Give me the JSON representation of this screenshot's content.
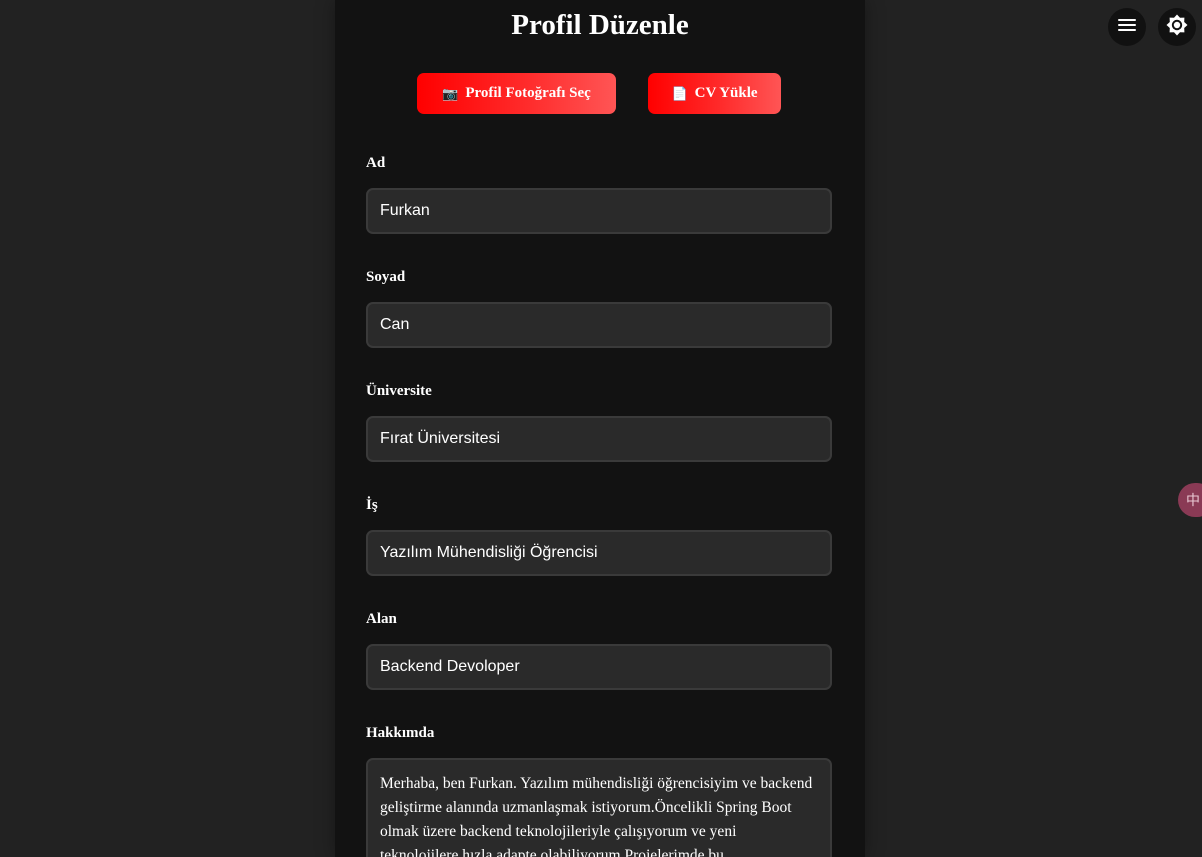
{
  "header": {
    "title": "Profil Düzenle"
  },
  "actions": {
    "photo_icon": "📷",
    "photo_label": "Profil Fotoğrafı Seç",
    "cv_icon": "📄",
    "cv_label": "CV Yükle"
  },
  "form": {
    "ad_label": "Ad",
    "ad_value": "Furkan",
    "soyad_label": "Soyad",
    "soyad_value": "Can",
    "universite_label": "Üniversite",
    "universite_value": "Fırat Üniversitesi",
    "is_label": "İş",
    "is_value": "Yazılım Mühendisliği Öğrencisi",
    "alan_label": "Alan",
    "alan_value": "Backend Devoloper",
    "hakkimda_label": "Hakkımda",
    "hakkimda_value": "Merhaba, ben Furkan. Yazılım mühendisliği öğrencisiyim ve backend geliştirme alanında uzmanlaşmak istiyorum.Öncelikli Spring Boot olmak üzere backend teknolojileriyle çalışıyorum ve yeni teknolojilere hızla adapte olabiliyorum.Projelerimde bu"
  },
  "toolbar": {
    "menu_icon": "hamburger-menu-icon",
    "theme_icon": "brightness-icon"
  },
  "side_tab": {
    "icon": "translate-icon",
    "glyph": "中"
  },
  "colors": {
    "background": "#222222",
    "panel": "#121212",
    "input_bg": "#2a2a2a",
    "accent_start": "#ff0000",
    "accent_end": "#ff5555"
  }
}
